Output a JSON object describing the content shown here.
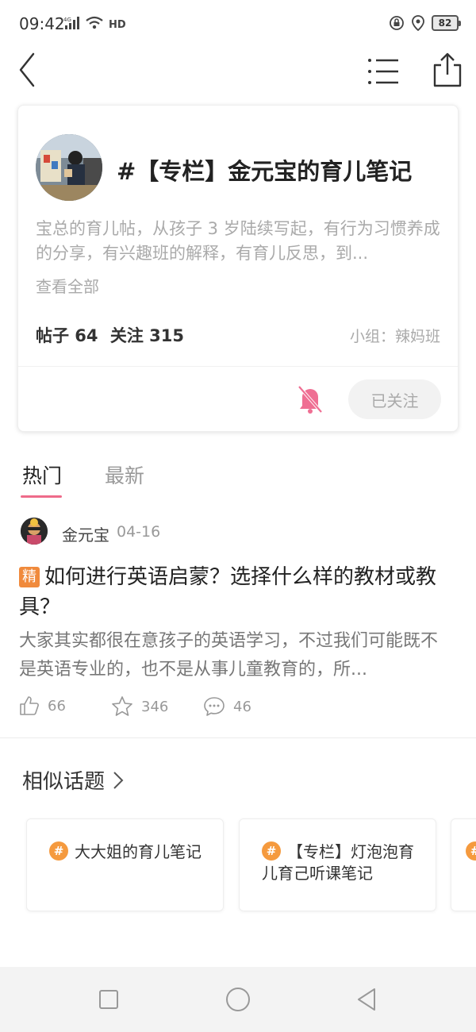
{
  "status_bar": {
    "time": "09:42",
    "signal_label": "4G",
    "hd_label": "HD",
    "battery": "82"
  },
  "toolbar": {
    "back_icon": "chevron-left-icon",
    "menu_icon": "list-icon",
    "share_icon": "share-icon"
  },
  "topic": {
    "title": "#【专栏】金元宝的育儿笔记",
    "description": "宝总的育儿帖，从孩子 3 岁陆续写起，有行为习惯养成的分享，有兴趣班的解释，有育儿反思，到...",
    "view_all": "查看全部",
    "posts_label": "帖子 64",
    "follows_label": "关注 315",
    "group": "小组：辣妈班",
    "follow_button": "已关注",
    "accent_color": "#ee6b8a"
  },
  "tabs": [
    {
      "label": "热门",
      "active": true
    },
    {
      "label": "最新",
      "active": false
    }
  ],
  "post": {
    "author": "金元宝",
    "date": "04-16",
    "badge": "精",
    "title": "如何进行英语启蒙？选择什么样的教材或教具？",
    "excerpt": "大家其实都很在意孩子的英语学习，不过我们可能既不是英语专业的，也不是从事儿童教育的，所...",
    "likes": "66",
    "favorites": "346",
    "comments": "46"
  },
  "similar": {
    "title": "相似话题",
    "items": [
      {
        "label": "大大姐的育儿笔记"
      },
      {
        "label": "【专栏】灯泡泡育儿育己听课笔记"
      }
    ]
  }
}
